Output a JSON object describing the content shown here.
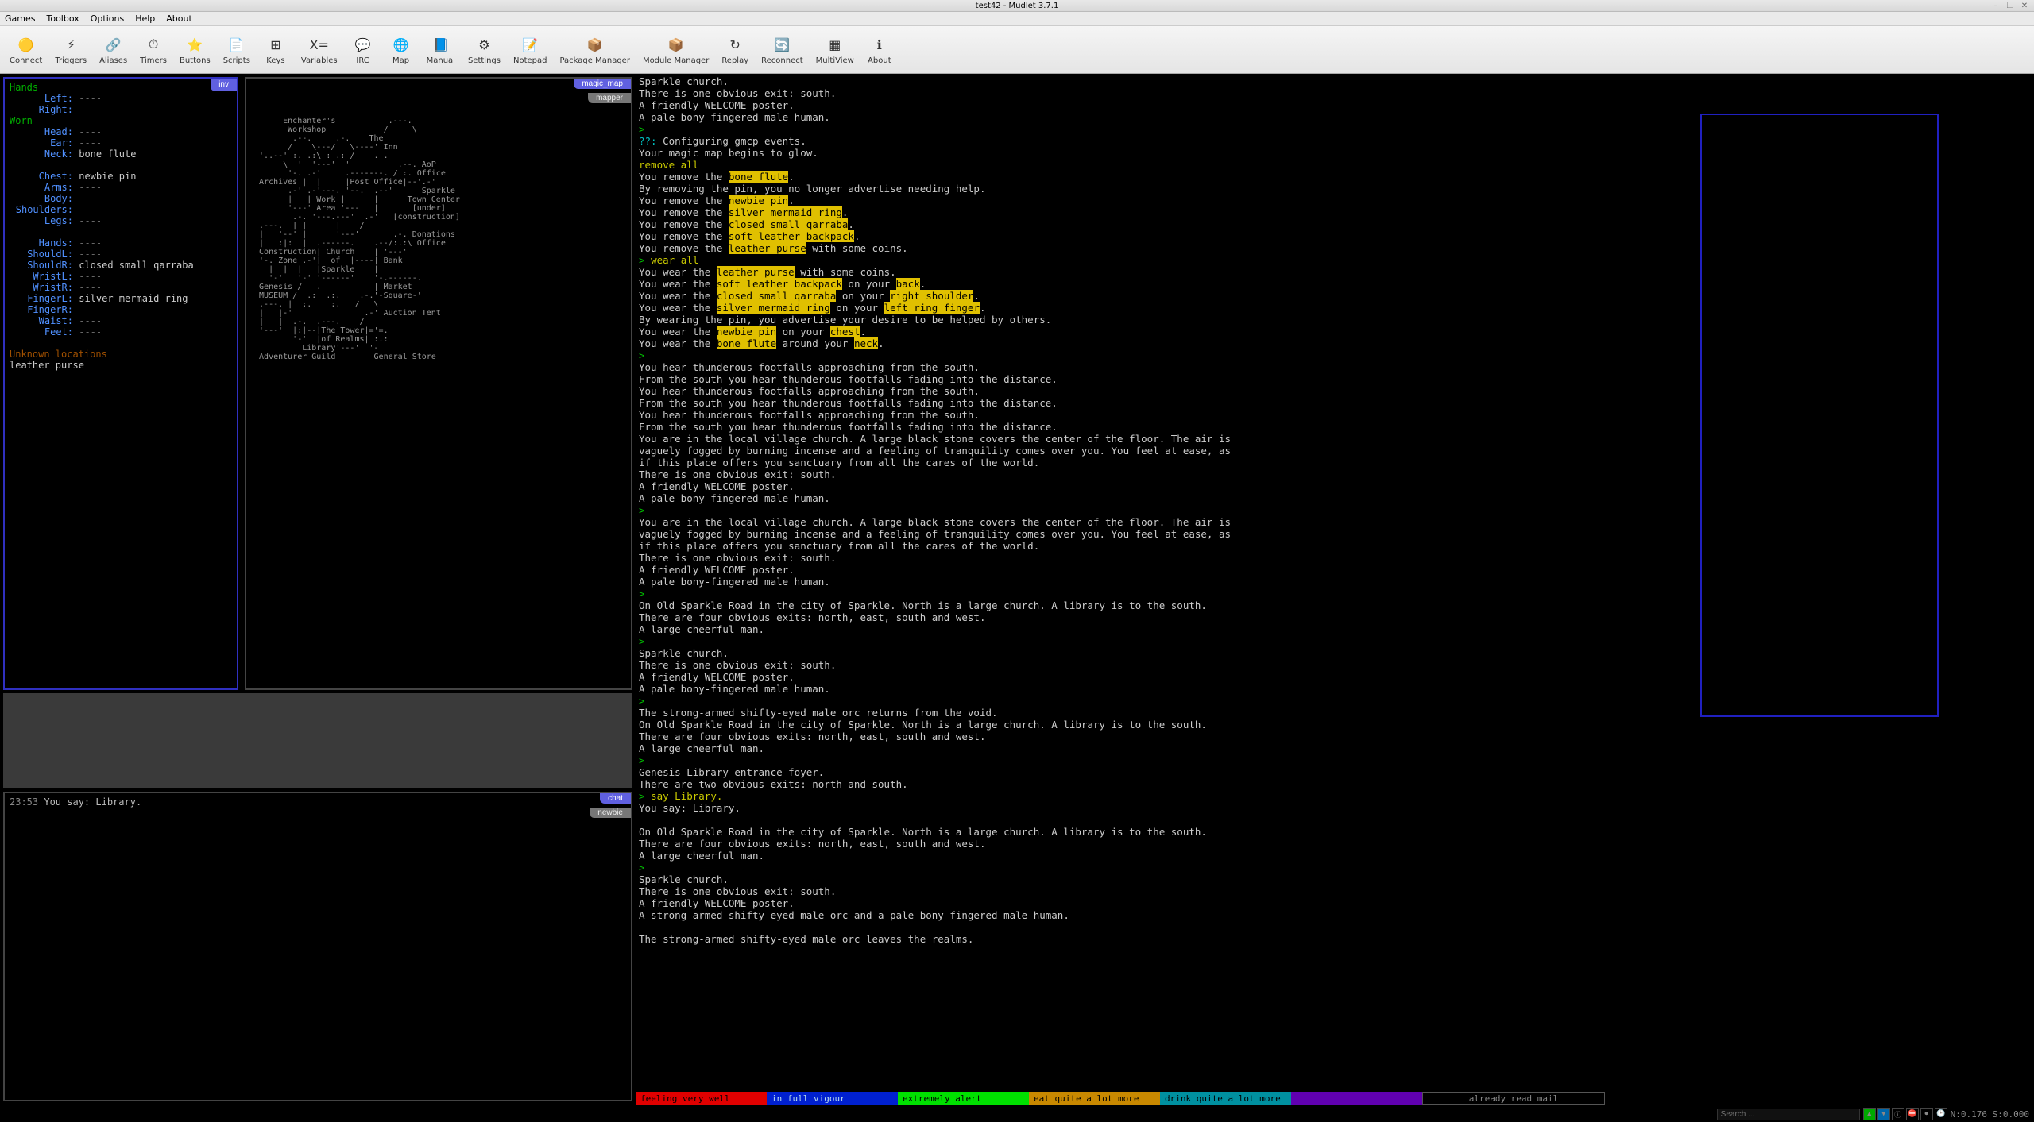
{
  "window": {
    "title": "test42 - Mudlet 3.7.1"
  },
  "menubar": [
    "Games",
    "Toolbox",
    "Options",
    "Help",
    "About"
  ],
  "toolbar": [
    {
      "label": "Connect",
      "glyph": "🟡"
    },
    {
      "label": "Triggers",
      "glyph": "⚡"
    },
    {
      "label": "Aliases",
      "glyph": "🔗"
    },
    {
      "label": "Timers",
      "glyph": "⏱"
    },
    {
      "label": "Buttons",
      "glyph": "⭐"
    },
    {
      "label": "Scripts",
      "glyph": "📄"
    },
    {
      "label": "Keys",
      "glyph": "⊞"
    },
    {
      "label": "Variables",
      "glyph": "X="
    },
    {
      "label": "IRC",
      "glyph": "💬"
    },
    {
      "label": "Map",
      "glyph": "🌐"
    },
    {
      "label": "Manual",
      "glyph": "📘"
    },
    {
      "label": "Settings",
      "glyph": "⚙"
    },
    {
      "label": "Notepad",
      "glyph": "📝"
    },
    {
      "label": "Package Manager",
      "glyph": "📦"
    },
    {
      "label": "Module Manager",
      "glyph": "📦"
    },
    {
      "label": "Replay",
      "glyph": "↻"
    },
    {
      "label": "Reconnect",
      "glyph": "🔄"
    },
    {
      "label": "MultiView",
      "glyph": "▦"
    },
    {
      "label": "About",
      "glyph": "ℹ"
    }
  ],
  "tabs": {
    "inv": "inv",
    "magic_map": "magic_map",
    "mapper": "mapper",
    "chat": "chat",
    "newbie": "newbie"
  },
  "inventory": {
    "hands_header": "Hands",
    "left": "Left:",
    "left_v": "----",
    "right": "Right:",
    "right_v": "----",
    "worn_header": "Worn",
    "head": "Head:",
    "head_v": "----",
    "ear": "Ear:",
    "ear_v": "----",
    "neck": "Neck:",
    "neck_v": "bone flute",
    "chest": "Chest:",
    "chest_v": "newbie pin",
    "arms": "Arms:",
    "arms_v": "----",
    "body": "Body:",
    "body_v": "----",
    "shoulders": "Shoulders:",
    "shoulders_v": "----",
    "legs": "Legs:",
    "legs_v": "----",
    "hands": "Hands:",
    "hands_v": "----",
    "shouldl": "ShouldL:",
    "shouldl_v": "----",
    "shouldr": "ShouldR:",
    "shouldr_v": "closed small qarraba",
    "wristl": "WristL:",
    "wristl_v": "----",
    "wristr": "WristR:",
    "wristr_v": "----",
    "fingerl": "FingerL:",
    "fingerl_v": "silver mermaid ring",
    "fingerr": "FingerR:",
    "fingerr_v": "----",
    "waist": "Waist:",
    "waist_v": "----",
    "feet": "Feet:",
    "feet_v": "----",
    "unknown_header": "Unknown locations",
    "unknown_item": "leather purse"
  },
  "ascii_map": "       Enchanter's           .---.\n        Workshop            /     \\\n         .--.     .-.    The\n        /    \\---/   \\----' Inn\n  '..--' :. .:\\ : .: /    . . \n       \\  '  '---'  '          .--. AoP\n        '-. .-'     .-------. / :. Office\n  Archives |  |     |Post Office|--'.-'\n        .-' .-'---. '--.  .--'      Sparkle\n        |   | Work |   |  |      Town Center\n        '---' Area '---'  |       [under]\n         .-. '---.---'  .-'   [construction]\n  .---.  | |      |    /\n  |   '--' |      '---'       .-. Donations\n  |   :|:  |  .------.    .--/:.:\\ Office\n  Construction| Church    | '---'\n  '-. Zone .-'|  of  |----| Bank\n    |  |  |   |Sparkle    |\n    '-'   '-' '------'    '-.------.\n  Genesis /   .           | Market\n  MUSEUM /  .:  .:.    .-.'-Square-'\n  .---. |  :.    :.   /   \\   \n  |   |-'               .-' Auction Tent\n  |   |  .-.  .---.    /\n  '---'  |:|--|The Tower|='=.\n         '-'  |of Realms| :.:\n           Library'---'  '-'\n  Adventurer Guild        General Store",
  "chat": {
    "ts": "23:53",
    "line": "You say: Library."
  },
  "status": {
    "hp": "feeling very well",
    "mana": "in full vigour",
    "alert": "extremely alert",
    "food": "eat quite a lot more",
    "drink": "drink quite a lot more",
    "intox": "",
    "mail": "already read mail"
  },
  "search_placeholder": "Search ...",
  "net_stats": "N:0.176 S:0.000",
  "console_html": "Sparkle church.\nThere is one obvious exit: south.\nA friendly WELCOME poster.\nA pale bony-fingered male human.\n<span class='g'>&gt;</span>\n<span class='cy'>??:</span> Configuring gmcp events.\nYour magic map begins to glow.\n<span class='y'>remove all</span>\nYou remove the <span class='hl'>bone flute</span>.\nBy removing the pin, you no longer advertise needing help.\nYou remove the <span class='hl'>newbie pin</span>.\nYou remove the <span class='hl'>silver mermaid ring</span>.\nYou remove the <span class='hl'>closed small qarraba</span>.\nYou remove the <span class='hl'>soft leather backpack</span>.\nYou remove the <span class='hl'>leather purse</span> with some coins.\n<span class='g'>&gt;</span> <span class='y'>wear all</span>\nYou wear the <span class='hl'>leather purse</span> with some coins.\nYou wear the <span class='hl'>soft leather backpack</span> on your <span class='hl'>back</span>.\nYou wear the <span class='hl'>closed small qarraba</span> on your <span class='hl'>right shoulder</span>.\nYou wear the <span class='hl'>silver mermaid ring</span> on your <span class='hl'>left ring finger</span>.\nBy wearing the pin, you advertise your desire to be helped by others.\nYou wear the <span class='hl'>newbie pin</span> on your <span class='hl'>chest</span>.\nYou wear the <span class='hl'>bone flute</span> around your <span class='hl'>neck</span>.\n<span class='g'>&gt;</span>\nYou hear thunderous footfalls approaching from the south.\nFrom the south you hear thunderous footfalls fading into the distance.\nYou hear thunderous footfalls approaching from the south.\nFrom the south you hear thunderous footfalls fading into the distance.\nYou hear thunderous footfalls approaching from the south.\nFrom the south you hear thunderous footfalls fading into the distance.\nYou are in the local village church. A large black stone covers the center of the floor. The air is\nvaguely fogged by burning incense and a feeling of tranquility comes over you. You feel at ease, as\nif this place offers you sanctuary from all the cares of the world.\nThere is one obvious exit: south.\nA friendly WELCOME poster.\nA pale bony-fingered male human.\n<span class='g'>&gt;</span>\nYou are in the local village church. A large black stone covers the center of the floor. The air is\nvaguely fogged by burning incense and a feeling of tranquility comes over you. You feel at ease, as\nif this place offers you sanctuary from all the cares of the world.\nThere is one obvious exit: south.\nA friendly WELCOME poster.\nA pale bony-fingered male human.\n<span class='g'>&gt;</span>\nOn Old Sparkle Road in the city of Sparkle. North is a large church. A library is to the south.\nThere are four obvious exits: north, east, south and west.\nA large cheerful man.\n<span class='g'>&gt;</span>\nSparkle church.\nThere is one obvious exit: south.\nA friendly WELCOME poster.\nA pale bony-fingered male human.\n<span class='g'>&gt;</span>\nThe strong-armed shifty-eyed male orc returns from the void.\nOn Old Sparkle Road in the city of Sparkle. North is a large church. A library is to the south.\nThere are four obvious exits: north, east, south and west.\nA large cheerful man.\n<span class='g'>&gt;</span>\nGenesis Library entrance foyer.\nThere are two obvious exits: north and south.\n<span class='g'>&gt;</span> <span class='y'>say Library.</span>\nYou say: Library.\n\nOn Old Sparkle Road in the city of Sparkle. North is a large church. A library is to the south.\nThere are four obvious exits: north, east, south and west.\nA large cheerful man.\n<span class='g'>&gt;</span>\nSparkle church.\nThere is one obvious exit: south.\nA friendly WELCOME poster.\nA strong-armed shifty-eyed male orc and a pale bony-fingered male human.\n\nThe strong-armed shifty-eyed male orc leaves the realms."
}
